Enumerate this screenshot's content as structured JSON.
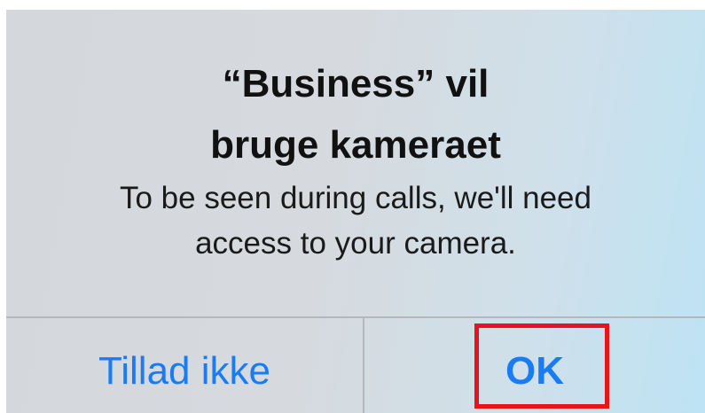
{
  "alert": {
    "title_line1": "“Business” vil",
    "title_line2": "bruge kameraet",
    "message_line1": "To be seen during calls, we'll need",
    "message_line2": "access to your camera.",
    "deny_button_label": "Tillad ikke",
    "ok_button_label": "OK"
  },
  "colors": {
    "button_text": "#1a7cf5",
    "highlight_border": "#e8141b",
    "title_text": "#111111",
    "divider": "#b4b8bd"
  },
  "annotation": {
    "highlighted_element": "OK"
  }
}
